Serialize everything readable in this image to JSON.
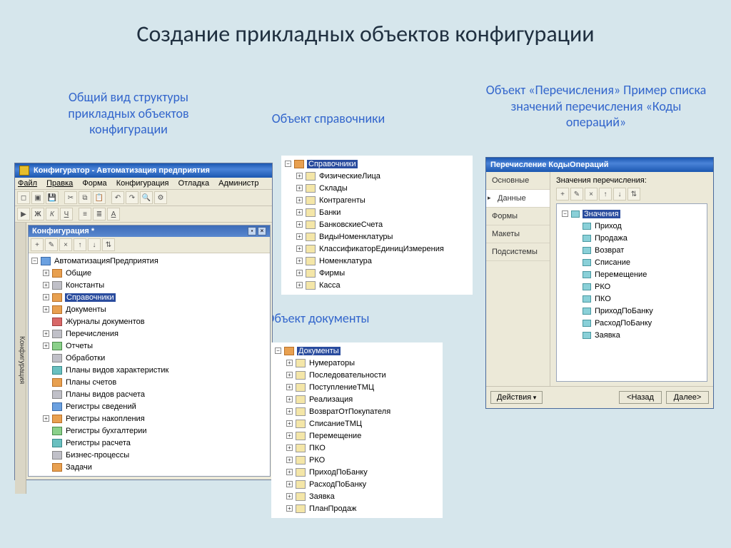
{
  "slide": {
    "title": "Создание прикладных объектов конфигурации",
    "caption_left": "Общий вид структуры прикладных объектов конфигурации",
    "caption_mid1": "Объект справочники",
    "caption_mid2": "Объект документы",
    "caption_right": "Объект «Перечисления» Пример списка значений перечисления «Коды операций»"
  },
  "configurator": {
    "title": "Конфигуратор - Автоматизация предприятия",
    "menu": [
      "Файл",
      "Правка",
      "Форма",
      "Конфигурация",
      "Отладка",
      "Администр"
    ],
    "sidebar_label": "Конфигурация",
    "sub_title": "Конфигурация *",
    "root": "АвтоматизацияПредприятия",
    "items": [
      {
        "label": "Общие",
        "icon": "orange",
        "toggle": "+"
      },
      {
        "label": "Константы",
        "icon": "gray",
        "toggle": "+"
      },
      {
        "label": "Справочники",
        "icon": "orange",
        "toggle": "+",
        "selected": true
      },
      {
        "label": "Документы",
        "icon": "orange",
        "toggle": "+"
      },
      {
        "label": "Журналы документов",
        "icon": "red",
        "toggle": ""
      },
      {
        "label": "Перечисления",
        "icon": "gray",
        "toggle": "+"
      },
      {
        "label": "Отчеты",
        "icon": "green",
        "toggle": "+"
      },
      {
        "label": "Обработки",
        "icon": "gray",
        "toggle": ""
      },
      {
        "label": "Планы видов характеристик",
        "icon": "teal",
        "toggle": ""
      },
      {
        "label": "Планы счетов",
        "icon": "orange",
        "toggle": ""
      },
      {
        "label": "Планы видов расчета",
        "icon": "gray",
        "toggle": ""
      },
      {
        "label": "Регистры сведений",
        "icon": "blue",
        "toggle": ""
      },
      {
        "label": "Регистры накопления",
        "icon": "orange",
        "toggle": "+"
      },
      {
        "label": "Регистры бухгалтерии",
        "icon": "green",
        "toggle": ""
      },
      {
        "label": "Регистры расчета",
        "icon": "teal",
        "toggle": ""
      },
      {
        "label": "Бизнес-процессы",
        "icon": "gray",
        "toggle": ""
      },
      {
        "label": "Задачи",
        "icon": "orange",
        "toggle": ""
      }
    ]
  },
  "sprav": {
    "header": "Справочники",
    "items": [
      "ФизическиеЛица",
      "Склады",
      "Контрагенты",
      "Банки",
      "БанковскиеСчета",
      "ВидыНоменклатуры",
      "КлассификаторЕдиницИзмерения",
      "Номенклатура",
      "Фирмы",
      "Касса"
    ]
  },
  "docs": {
    "header": "Документы",
    "items": [
      "Нумераторы",
      "Последовательности",
      "ПоступлениеТМЦ",
      "Реализация",
      "ВозвратОтПокупателя",
      "СписаниеТМЦ",
      "Перемещение",
      "ПКО",
      "РКО",
      "ПриходПоБанку",
      "РасходПоБанку",
      "Заявка",
      "ПланПродаж"
    ]
  },
  "enum": {
    "title": "Перечисление КодыОпераций",
    "tabs": [
      "Основные",
      "Данные",
      "Формы",
      "Макеты",
      "Подсистемы"
    ],
    "active_tab": "Данные",
    "list_header": "Значения перечисления:",
    "root": "Значения",
    "values": [
      "Приход",
      "Продажа",
      "Возврат",
      "Списание",
      "Перемещение",
      "РКО",
      "ПКО",
      "ПриходПоБанку",
      "РасходПоБанку",
      "Заявка"
    ],
    "buttons": {
      "actions": "Действия",
      "back": "<Назад",
      "next": "Далее>"
    }
  }
}
